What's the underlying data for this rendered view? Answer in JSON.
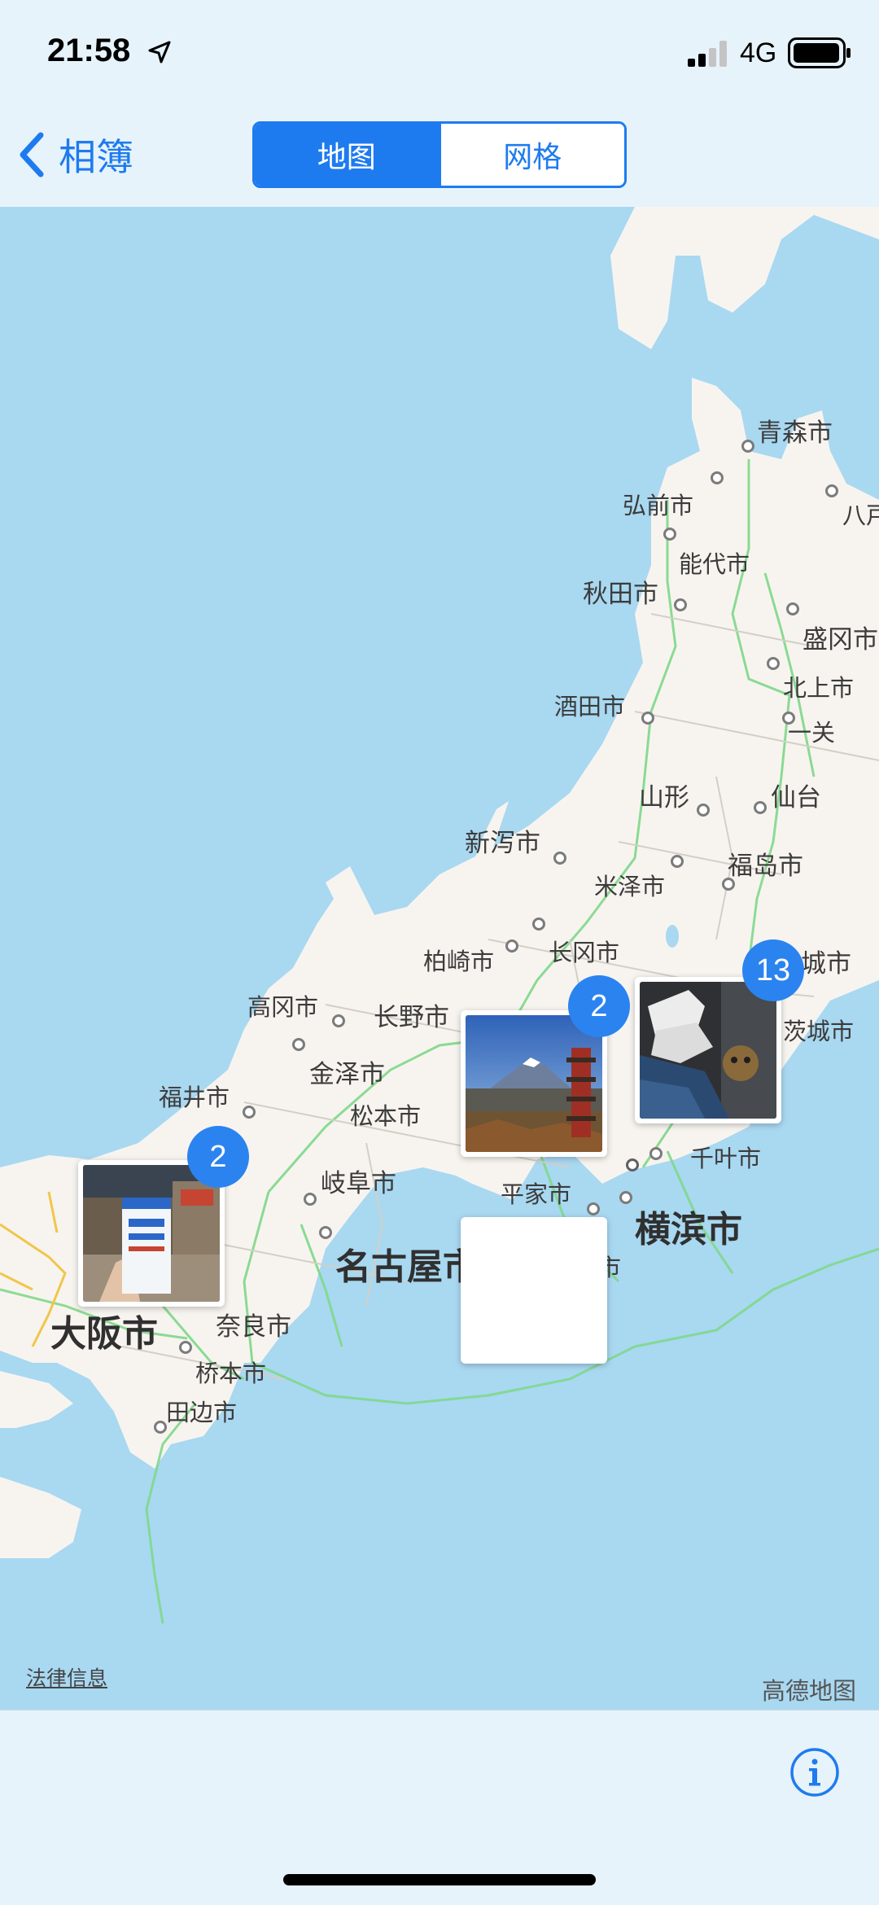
{
  "status_bar": {
    "time": "21:58",
    "network": "4G"
  },
  "nav": {
    "back_label": "相簿",
    "segments": [
      {
        "label": "地图",
        "active": true
      },
      {
        "label": "网格",
        "active": false
      }
    ]
  },
  "map": {
    "labels": [
      "青森市",
      "弘前市",
      "八戸",
      "能代市",
      "秋田市",
      "盛冈市",
      "北上市",
      "酒田市",
      "一关",
      "山形",
      "仙台",
      "新泻市",
      "福岛市",
      "米泽市",
      "柏崎市",
      "长冈市",
      "城市",
      "高冈市",
      "长野市",
      "茨城市",
      "金泽市",
      "福井市",
      "松本市",
      "千叶市",
      "岐阜市",
      "平家市",
      "横滨市",
      "名古屋市",
      "沼津市",
      "大阪市",
      "奈良市",
      "桥本市",
      "田边市"
    ],
    "clusters": [
      {
        "count": "2",
        "subject": "milk-carton-photo"
      },
      {
        "count": "2",
        "subject": "mount-fuji-pagoda-photo"
      },
      {
        "count": "13",
        "subject": "sneakers-photo"
      }
    ],
    "legal_label": "法律信息",
    "provider_label": "高德地图"
  },
  "colors": {
    "accent": "#1e7bef",
    "badge": "#2b83f0",
    "water": "#a9d8f1",
    "land": "#f7f4ef",
    "roads": "#7fd88a"
  }
}
